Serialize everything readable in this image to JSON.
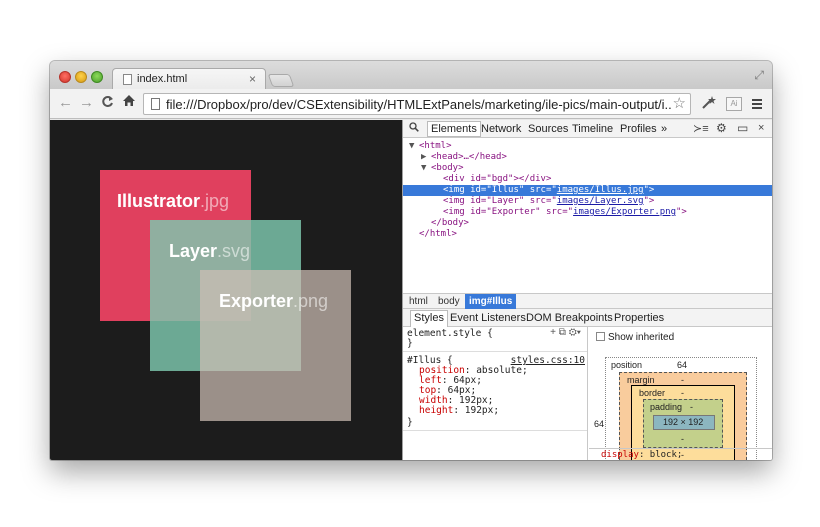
{
  "browser": {
    "tab": {
      "title": "index.html",
      "close": "×"
    },
    "url": "file:///Dropbox/pro/dev/CSExtensibility/HTMLExtPanels/marketing/ile-pics/main-output/i...",
    "nav": {
      "back": "←",
      "forward": "→",
      "reload": "C",
      "home": "⌂",
      "star": "☆"
    }
  },
  "canvas": {
    "background": "#1c1c1c",
    "squares": [
      {
        "name": "Illustrator",
        "ext": ".jpg",
        "color": "#e0405e"
      },
      {
        "name": "Layer",
        "ext": ".svg",
        "color": "#7ec8af"
      },
      {
        "name": "Exporter",
        "ext": ".png",
        "color": "#cdbeb4"
      }
    ]
  },
  "devtools": {
    "tabs": [
      "Elements",
      "Network",
      "Sources",
      "Timeline",
      "Profiles",
      "»"
    ],
    "active_tab": "Elements",
    "tools": {
      "console": "≻≡",
      "settings": "⚙",
      "dock": "▭",
      "close": "×"
    },
    "dom": [
      {
        "tri": "▼",
        "pre": "<html>",
        "indent": 0
      },
      {
        "tri": "▶",
        "pre": "<head>…</head>",
        "indent": 1
      },
      {
        "tri": "▼",
        "pre": "<body>",
        "indent": 1
      },
      {
        "tri": "",
        "pre": "<div id=\"bgd\"></div>",
        "indent": 2
      },
      {
        "tri": "",
        "pre": "<img id=\"Illus\" src=\"",
        "link": "images/Illus.jpg",
        "post": "\">",
        "indent": 2,
        "selected": true
      },
      {
        "tri": "",
        "pre": "<img id=\"Layer\" src=\"",
        "link": "images/Layer.svg",
        "post": "\">",
        "indent": 2
      },
      {
        "tri": "",
        "pre": "<img id=\"Exporter\" src=\"",
        "link": "images/Exporter.png",
        "post": "\">",
        "indent": 2
      },
      {
        "tri": "",
        "pre": "</body>",
        "indent": 1
      },
      {
        "tri": "",
        "pre": "</html>",
        "indent": 0
      }
    ],
    "breadcrumbs": [
      "html",
      "body",
      "img#Illus"
    ],
    "sub_tabs": [
      "Styles",
      "Event Listeners",
      "DOM Breakpoints",
      "Properties"
    ],
    "styles": {
      "element_style": "element.style {",
      "element_style_close": "}",
      "element_style_tools": "+ ⧉ ⚙▾",
      "rule_selector": "#Illus {",
      "rule_source": "styles.css:10",
      "props": [
        {
          "name": "position",
          "value": "absolute;"
        },
        {
          "name": "left",
          "value": "64px;"
        },
        {
          "name": "top",
          "value": "64px;"
        },
        {
          "name": "width",
          "value": "192px;"
        },
        {
          "name": "height",
          "value": "192px;"
        }
      ],
      "rule_close": "}"
    },
    "metrics": {
      "show_inherited": "Show inherited",
      "position_label": "position",
      "position_top": "64",
      "position_left": "64",
      "margin_label": "margin",
      "border_label": "border",
      "padding_label": "padding",
      "dash": "-",
      "content": "192 × 192"
    },
    "computed": {
      "prop": "display",
      "value": "block;"
    }
  }
}
